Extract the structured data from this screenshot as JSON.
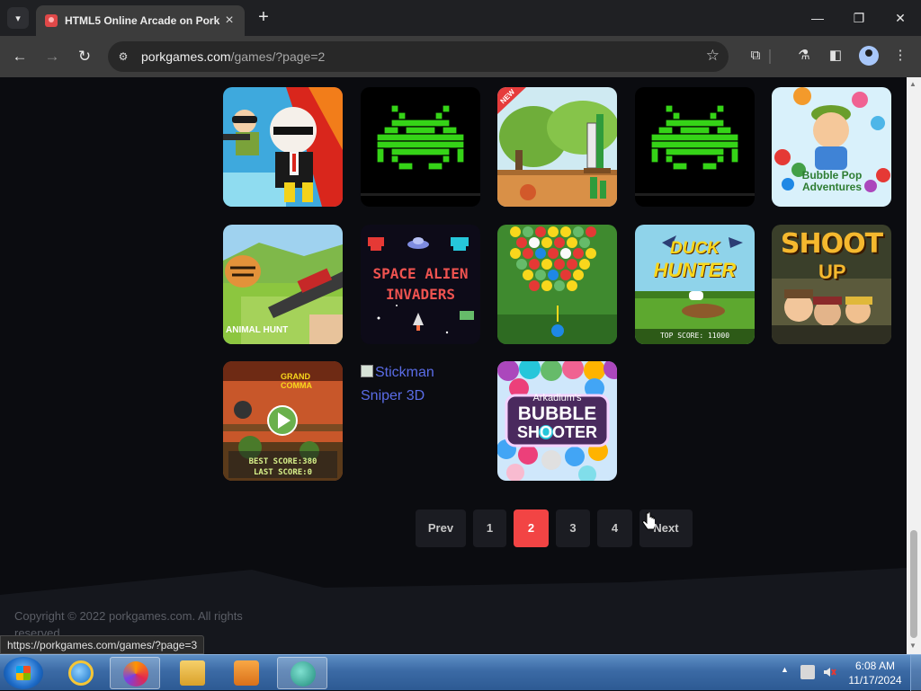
{
  "browser": {
    "tab_title": "HTML5 Online Arcade on Pork",
    "url_host": "porkgames.com",
    "url_path": "/games/?page=2",
    "new_tab": "+",
    "minimize": "—",
    "maximize": "❐",
    "close": "✕"
  },
  "games": [
    {
      "row": 0,
      "col": 0,
      "art": "agent-shooter"
    },
    {
      "row": 0,
      "col": 1,
      "art": "invader-green"
    },
    {
      "row": 0,
      "col": 2,
      "art": "bottle-shooting",
      "badge": "NEW"
    },
    {
      "row": 0,
      "col": 3,
      "art": "invader-green"
    },
    {
      "row": 0,
      "col": 4,
      "art": "bubble-pop-adventures",
      "caption": "Bubble Pop Adventures"
    },
    {
      "row": 1,
      "col": 0,
      "art": "animal-hunt",
      "caption": "ANIMAL HUNT"
    },
    {
      "row": 1,
      "col": 1,
      "art": "space-alien-invaders",
      "caption_1": "SPACE ALIEN",
      "caption_2": "INVADERS"
    },
    {
      "row": 1,
      "col": 2,
      "art": "bubble-shooter-classic"
    },
    {
      "row": 1,
      "col": 3,
      "art": "duck-hunter",
      "caption_1": "DUCK",
      "caption_2": "HUNTER",
      "score": "TOP SCORE: 11000"
    },
    {
      "row": 1,
      "col": 4,
      "art": "shoot-up",
      "caption_1": "SHOOT",
      "caption_2": "UP"
    },
    {
      "row": 2,
      "col": 0,
      "art": "grand-commando",
      "caption": "GRAND COMMA",
      "best": "BEST SCORE:380",
      "last": "LAST SCORE:0"
    },
    {
      "row": 2,
      "col": 1,
      "art": "broken-image",
      "alt_1": "Stickman",
      "alt_2": "Sniper 3D"
    },
    {
      "row": 2,
      "col": 2,
      "art": "arkadium-bubble-shooter",
      "caption_1": "Arkadium's",
      "caption_2": "BUBBLE",
      "caption_3": "SHOOTER"
    }
  ],
  "pagination": {
    "prev": "Prev",
    "pages": [
      "1",
      "2",
      "3",
      "4"
    ],
    "current": "2",
    "next": "Next"
  },
  "footer": {
    "copyright": "Copyright © 2022 porkgames.com. All rights reserved."
  },
  "status_url": "https://porkgames.com/games/?page=3",
  "taskbar": {
    "time": "6:08 AM",
    "date": "11/17/2024"
  },
  "colors": {
    "page_bg": "#0b0c10",
    "accent_active_page": "#f24444",
    "link": "#5a6ce6"
  }
}
